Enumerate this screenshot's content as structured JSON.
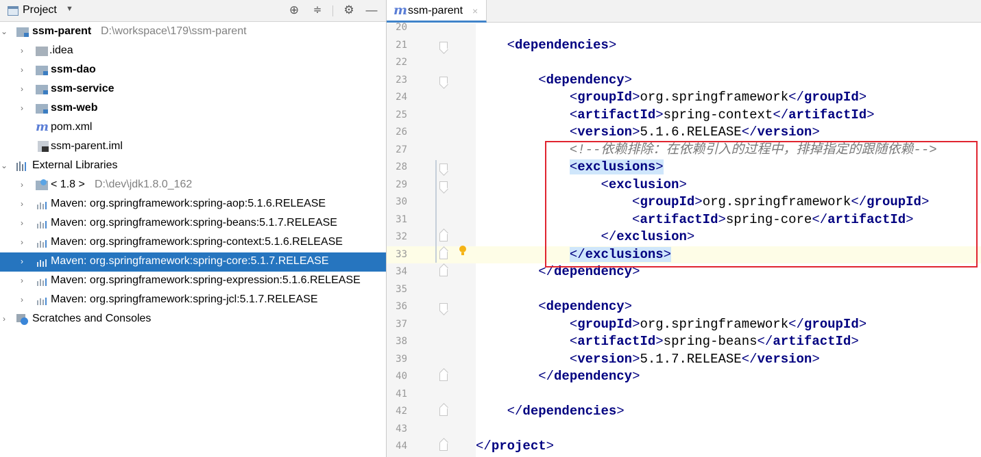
{
  "project_panel": {
    "title": "Project",
    "icons": [
      "project-view-icon",
      "locate-icon",
      "collapse-all-icon",
      "settings-icon",
      "hide-icon"
    ]
  },
  "tree": [
    {
      "label": "ssm-parent",
      "suffix": "D:\\workspace\\179\\ssm-parent",
      "bold": true,
      "expanded": true,
      "icon": "module-folder-icon"
    },
    {
      "label": ".idea",
      "icon": "folder-icon"
    },
    {
      "label": "ssm-dao",
      "bold": true,
      "icon": "module-folder-icon"
    },
    {
      "label": "ssm-service",
      "bold": true,
      "icon": "module-folder-icon"
    },
    {
      "label": "ssm-web",
      "bold": true,
      "icon": "module-folder-icon"
    },
    {
      "label": "pom.xml",
      "icon": "maven-icon"
    },
    {
      "label": "ssm-parent.iml",
      "icon": "iml-file-icon"
    },
    {
      "label": "External Libraries",
      "expanded": true,
      "icon": "libraries-icon"
    },
    {
      "label": "< 1.8 >",
      "suffix": "D:\\dev\\jdk1.8.0_162",
      "icon": "jdk-icon"
    },
    {
      "label": "Maven: org.springframework:spring-aop:5.1.6.RELEASE",
      "icon": "library-jar-icon"
    },
    {
      "label": "Maven: org.springframework:spring-beans:5.1.7.RELEASE",
      "icon": "library-jar-icon"
    },
    {
      "label": "Maven: org.springframework:spring-context:5.1.6.RELEASE",
      "icon": "library-jar-icon"
    },
    {
      "label": "Maven: org.springframework:spring-core:5.1.7.RELEASE",
      "icon": "library-jar-icon",
      "selected": true
    },
    {
      "label": "Maven: org.springframework:spring-expression:5.1.6.RELEASE",
      "icon": "library-jar-icon"
    },
    {
      "label": "Maven: org.springframework:spring-jcl:5.1.7.RELEASE",
      "icon": "library-jar-icon"
    },
    {
      "label": "Scratches and Consoles",
      "icon": "scratches-icon"
    }
  ],
  "editor": {
    "tab_label": "ssm-parent",
    "tab_icon": "maven-icon",
    "current_line": 33,
    "highlight_color": "#cfe6fb",
    "annotation_color": "#e0242f",
    "lines": [
      {
        "no": "20",
        "text": ""
      },
      {
        "no": "21",
        "text": "    <dependencies>"
      },
      {
        "no": "22",
        "text": ""
      },
      {
        "no": "23",
        "text": "        <dependency>"
      },
      {
        "no": "24",
        "text": "            <groupId>org.springframework</groupId>"
      },
      {
        "no": "25",
        "text": "            <artifactId>spring-context</artifactId>"
      },
      {
        "no": "26",
        "text": "            <version>5.1.6.RELEASE</version>"
      },
      {
        "no": "27",
        "text": "            <!--依赖排除：在依赖引入的过程中，排掉指定的跟随依赖-->"
      },
      {
        "no": "28",
        "text": "            <exclusions>"
      },
      {
        "no": "29",
        "text": "                <exclusion>"
      },
      {
        "no": "30",
        "text": "                    <groupId>org.springframework</groupId>"
      },
      {
        "no": "31",
        "text": "                    <artifactId>spring-core</artifactId>"
      },
      {
        "no": "32",
        "text": "                </exclusion>"
      },
      {
        "no": "33",
        "text": "            </exclusions>"
      },
      {
        "no": "34",
        "text": "        </dependency>"
      },
      {
        "no": "35",
        "text": ""
      },
      {
        "no": "36",
        "text": "        <dependency>"
      },
      {
        "no": "37",
        "text": "            <groupId>org.springframework</groupId>"
      },
      {
        "no": "38",
        "text": "            <artifactId>spring-beans</artifactId>"
      },
      {
        "no": "39",
        "text": "            <version>5.1.7.RELEASE</version>"
      },
      {
        "no": "40",
        "text": "        </dependency>"
      },
      {
        "no": "41",
        "text": ""
      },
      {
        "no": "42",
        "text": "    </dependencies>"
      },
      {
        "no": "43",
        "text": ""
      },
      {
        "no": "44",
        "text": "</project>"
      }
    ]
  }
}
